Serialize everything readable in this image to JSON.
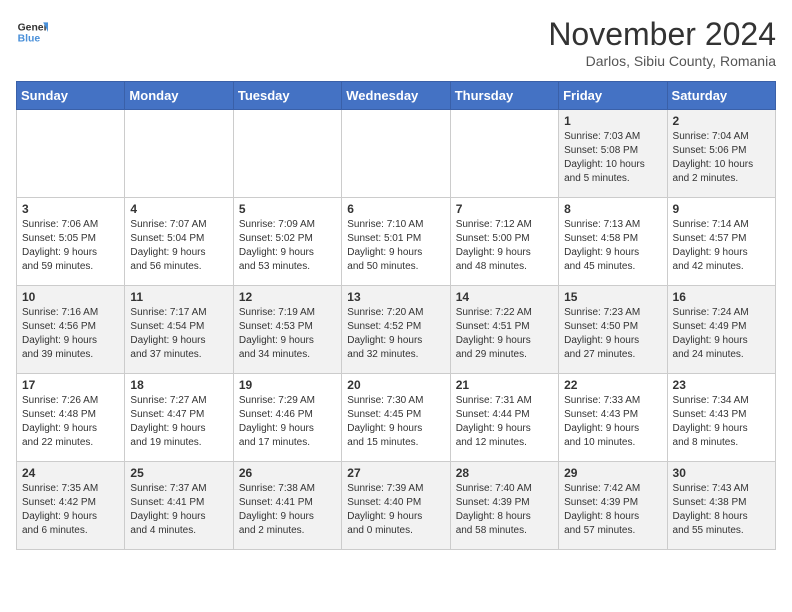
{
  "logo": {
    "line1": "General",
    "line2": "Blue"
  },
  "title": "November 2024",
  "subtitle": "Darlos, Sibiu County, Romania",
  "days_of_week": [
    "Sunday",
    "Monday",
    "Tuesday",
    "Wednesday",
    "Thursday",
    "Friday",
    "Saturday"
  ],
  "weeks": [
    [
      {
        "day": "",
        "info": ""
      },
      {
        "day": "",
        "info": ""
      },
      {
        "day": "",
        "info": ""
      },
      {
        "day": "",
        "info": ""
      },
      {
        "day": "",
        "info": ""
      },
      {
        "day": "1",
        "info": "Sunrise: 7:03 AM\nSunset: 5:08 PM\nDaylight: 10 hours\nand 5 minutes."
      },
      {
        "day": "2",
        "info": "Sunrise: 7:04 AM\nSunset: 5:06 PM\nDaylight: 10 hours\nand 2 minutes."
      }
    ],
    [
      {
        "day": "3",
        "info": "Sunrise: 7:06 AM\nSunset: 5:05 PM\nDaylight: 9 hours\nand 59 minutes."
      },
      {
        "day": "4",
        "info": "Sunrise: 7:07 AM\nSunset: 5:04 PM\nDaylight: 9 hours\nand 56 minutes."
      },
      {
        "day": "5",
        "info": "Sunrise: 7:09 AM\nSunset: 5:02 PM\nDaylight: 9 hours\nand 53 minutes."
      },
      {
        "day": "6",
        "info": "Sunrise: 7:10 AM\nSunset: 5:01 PM\nDaylight: 9 hours\nand 50 minutes."
      },
      {
        "day": "7",
        "info": "Sunrise: 7:12 AM\nSunset: 5:00 PM\nDaylight: 9 hours\nand 48 minutes."
      },
      {
        "day": "8",
        "info": "Sunrise: 7:13 AM\nSunset: 4:58 PM\nDaylight: 9 hours\nand 45 minutes."
      },
      {
        "day": "9",
        "info": "Sunrise: 7:14 AM\nSunset: 4:57 PM\nDaylight: 9 hours\nand 42 minutes."
      }
    ],
    [
      {
        "day": "10",
        "info": "Sunrise: 7:16 AM\nSunset: 4:56 PM\nDaylight: 9 hours\nand 39 minutes."
      },
      {
        "day": "11",
        "info": "Sunrise: 7:17 AM\nSunset: 4:54 PM\nDaylight: 9 hours\nand 37 minutes."
      },
      {
        "day": "12",
        "info": "Sunrise: 7:19 AM\nSunset: 4:53 PM\nDaylight: 9 hours\nand 34 minutes."
      },
      {
        "day": "13",
        "info": "Sunrise: 7:20 AM\nSunset: 4:52 PM\nDaylight: 9 hours\nand 32 minutes."
      },
      {
        "day": "14",
        "info": "Sunrise: 7:22 AM\nSunset: 4:51 PM\nDaylight: 9 hours\nand 29 minutes."
      },
      {
        "day": "15",
        "info": "Sunrise: 7:23 AM\nSunset: 4:50 PM\nDaylight: 9 hours\nand 27 minutes."
      },
      {
        "day": "16",
        "info": "Sunrise: 7:24 AM\nSunset: 4:49 PM\nDaylight: 9 hours\nand 24 minutes."
      }
    ],
    [
      {
        "day": "17",
        "info": "Sunrise: 7:26 AM\nSunset: 4:48 PM\nDaylight: 9 hours\nand 22 minutes."
      },
      {
        "day": "18",
        "info": "Sunrise: 7:27 AM\nSunset: 4:47 PM\nDaylight: 9 hours\nand 19 minutes."
      },
      {
        "day": "19",
        "info": "Sunrise: 7:29 AM\nSunset: 4:46 PM\nDaylight: 9 hours\nand 17 minutes."
      },
      {
        "day": "20",
        "info": "Sunrise: 7:30 AM\nSunset: 4:45 PM\nDaylight: 9 hours\nand 15 minutes."
      },
      {
        "day": "21",
        "info": "Sunrise: 7:31 AM\nSunset: 4:44 PM\nDaylight: 9 hours\nand 12 minutes."
      },
      {
        "day": "22",
        "info": "Sunrise: 7:33 AM\nSunset: 4:43 PM\nDaylight: 9 hours\nand 10 minutes."
      },
      {
        "day": "23",
        "info": "Sunrise: 7:34 AM\nSunset: 4:43 PM\nDaylight: 9 hours\nand 8 minutes."
      }
    ],
    [
      {
        "day": "24",
        "info": "Sunrise: 7:35 AM\nSunset: 4:42 PM\nDaylight: 9 hours\nand 6 minutes."
      },
      {
        "day": "25",
        "info": "Sunrise: 7:37 AM\nSunset: 4:41 PM\nDaylight: 9 hours\nand 4 minutes."
      },
      {
        "day": "26",
        "info": "Sunrise: 7:38 AM\nSunset: 4:41 PM\nDaylight: 9 hours\nand 2 minutes."
      },
      {
        "day": "27",
        "info": "Sunrise: 7:39 AM\nSunset: 4:40 PM\nDaylight: 9 hours\nand 0 minutes."
      },
      {
        "day": "28",
        "info": "Sunrise: 7:40 AM\nSunset: 4:39 PM\nDaylight: 8 hours\nand 58 minutes."
      },
      {
        "day": "29",
        "info": "Sunrise: 7:42 AM\nSunset: 4:39 PM\nDaylight: 8 hours\nand 57 minutes."
      },
      {
        "day": "30",
        "info": "Sunrise: 7:43 AM\nSunset: 4:38 PM\nDaylight: 8 hours\nand 55 minutes."
      }
    ]
  ]
}
